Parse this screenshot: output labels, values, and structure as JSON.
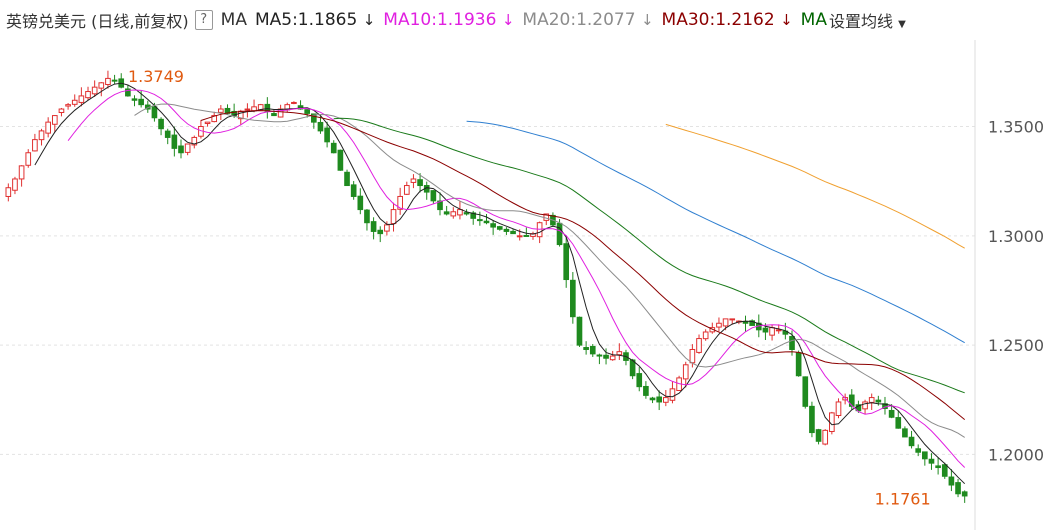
{
  "title": "英镑兑美元 (日线,前复权)",
  "help_icon": "?",
  "indicator": "MA",
  "ma_legend": [
    {
      "label": "MA5",
      "value": "1.1865",
      "arrow": "↓",
      "color": "#222222"
    },
    {
      "label": "MA10",
      "value": "1.1936",
      "arrow": "↓",
      "color": "#e020e0"
    },
    {
      "label": "MA20",
      "value": "1.2077",
      "arrow": "↓",
      "color": "#8c8c8c"
    },
    {
      "label": "MA30",
      "value": "1.2162",
      "arrow": "↓",
      "color": "#8b0000"
    }
  ],
  "ma_partial": {
    "label": "MA",
    "color": "#006400"
  },
  "settings": {
    "label": "设置均线",
    "icon": "caret-down-icon"
  },
  "colors": {
    "up": "#e03030",
    "down": "#1f8a1f",
    "annotation": "#e05a10",
    "grid": "#e3e3e3",
    "axis_text": "#555555"
  },
  "chart_data": {
    "type": "candlestick",
    "yticks": [
      "1.3500",
      "1.3000",
      "1.2500",
      "1.2000"
    ],
    "ylim": [
      1.17,
      1.385
    ],
    "annotations": [
      {
        "text": "1.3749",
        "value": 1.3749,
        "kind": "high"
      },
      {
        "text": "1.1761",
        "value": 1.1761,
        "kind": "low"
      }
    ],
    "close_series": [
      1.322,
      1.326,
      1.332,
      1.338,
      1.344,
      1.348,
      1.352,
      1.355,
      1.358,
      1.36,
      1.362,
      1.364,
      1.366,
      1.368,
      1.37,
      1.372,
      1.371,
      1.368,
      1.364,
      1.362,
      1.36,
      1.358,
      1.354,
      1.349,
      1.345,
      1.34,
      1.338,
      1.342,
      1.345,
      1.35,
      1.352,
      1.355,
      1.358,
      1.356,
      1.355,
      1.357,
      1.358,
      1.359,
      1.36,
      1.357,
      1.355,
      1.358,
      1.36,
      1.361,
      1.358,
      1.356,
      1.352,
      1.348,
      1.343,
      1.338,
      1.33,
      1.323,
      1.318,
      1.312,
      1.306,
      1.302,
      1.301,
      1.305,
      1.312,
      1.318,
      1.323,
      1.326,
      1.323,
      1.32,
      1.316,
      1.312,
      1.31,
      1.311,
      1.312,
      1.31,
      1.308,
      1.307,
      1.306,
      1.304,
      1.303,
      1.302,
      1.301,
      1.3,
      1.3,
      1.301,
      1.306,
      1.31,
      1.305,
      1.296,
      1.28,
      1.263,
      1.25,
      1.248,
      1.246,
      1.245,
      1.244,
      1.245,
      1.247,
      1.243,
      1.236,
      1.231,
      1.227,
      1.225,
      1.224,
      1.226,
      1.23,
      1.235,
      1.241,
      1.248,
      1.253,
      1.256,
      1.258,
      1.26,
      1.262,
      1.262,
      1.261,
      1.26,
      1.259,
      1.257,
      1.256,
      1.258,
      1.257,
      1.255,
      1.248,
      1.236,
      1.222,
      1.21,
      1.206,
      1.211,
      1.219,
      1.224,
      1.226,
      1.222,
      1.22,
      1.224,
      1.226,
      1.224,
      1.221,
      1.217,
      1.212,
      1.208,
      1.204,
      1.201,
      1.198,
      1.196,
      1.194,
      1.19,
      1.186,
      1.182,
      1.181
    ],
    "ma5": 1.1865,
    "ma10": 1.1936,
    "ma20": 1.2077,
    "ma30": 1.2162
  }
}
